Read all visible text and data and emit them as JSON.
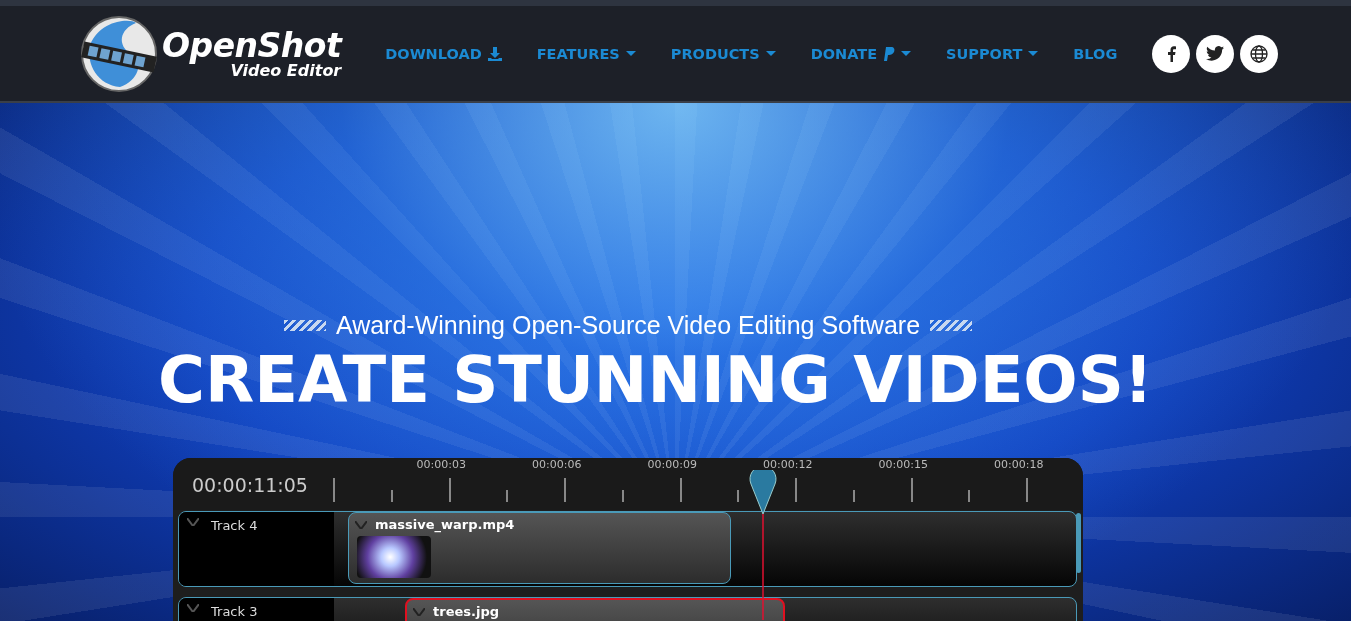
{
  "logo": {
    "title": "OpenShot",
    "subtitle": "Video Editor"
  },
  "nav": [
    {
      "label": "DOWNLOAD",
      "kind": "download"
    },
    {
      "label": "FEATURES",
      "kind": "dropdown"
    },
    {
      "label": "PRODUCTS",
      "kind": "dropdown"
    },
    {
      "label": "DONATE",
      "kind": "paypal"
    },
    {
      "label": "SUPPORT",
      "kind": "dropdown"
    },
    {
      "label": "BLOG",
      "kind": "plain"
    }
  ],
  "social": [
    {
      "kind": "facebook"
    },
    {
      "kind": "twitter"
    },
    {
      "kind": "globe"
    }
  ],
  "hero": {
    "tagline": "Award-Winning Open-Source Video Editing Software",
    "headline": "CREATE STUNNING VIDEOS!"
  },
  "timeline": {
    "timecode": "00:00:11:05",
    "ruler": [
      "00:00:03",
      "00:00:06",
      "00:00:09",
      "00:00:12",
      "00:00:15",
      "00:00:18"
    ],
    "tracks": [
      {
        "name": "Track 4",
        "clip": "massive_warp.mp4",
        "selected": false
      },
      {
        "name": "Track 3",
        "clip": "trees.jpg",
        "selected": true
      }
    ]
  }
}
